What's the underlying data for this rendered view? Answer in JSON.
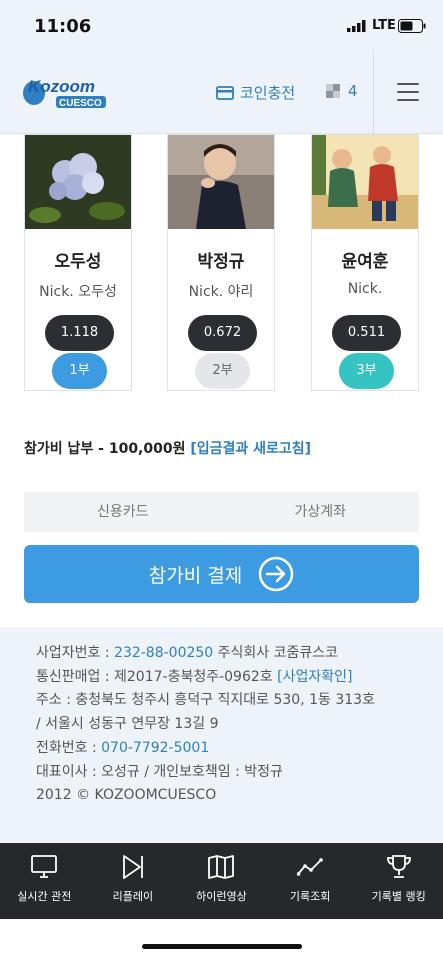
{
  "status": {
    "time": "11:06",
    "network": "LTE"
  },
  "header": {
    "logo_text": "Kozoom",
    "logo_sub": "CUESCO",
    "charge_label": "코인충전",
    "coin_count": "4"
  },
  "players": [
    {
      "name": "오두성",
      "nick": "Nick. 오두성",
      "score": "1.118",
      "part": "1부",
      "part_color": "#3d9be2"
    },
    {
      "name": "박정규",
      "nick": "Nick. 야리",
      "score": "0.672",
      "part": "2부",
      "part_color": "#e4e6ea"
    },
    {
      "name": "윤여훈",
      "nick": "Nick.",
      "score": "0.511",
      "part": "3부",
      "part_color": "#35c4c2"
    }
  ],
  "fee": {
    "text": "참가비 납부 - 100,000원 ",
    "refresh": "[입금결과 새로고침]"
  },
  "payment": {
    "tabs": [
      "신용카드",
      "가상계좌"
    ],
    "button_label": "참가비 결제"
  },
  "company": {
    "biz_label": "사업자번호 : ",
    "biz_no": "232-88-00250",
    "biz_name": " 주식회사 코줌큐스코",
    "sales_text": "통신판매업 : 제2017-충북청주-0962호 ",
    "sales_link": "[사업자확인]",
    "address": "주소 : 충청북도 청주시 흥덕구 직지대로 530, 1동 313호",
    "address2": "/ 서울시 성동구 연무장 13길 9",
    "phone_label": "전화번호 : ",
    "phone": "070-7792-5001",
    "ceo": "대표이사 : 오성규 / 개인보호책임 : 박정규",
    "copyright": "2012 © KOZOOMCUESCO"
  },
  "tabbar": [
    {
      "label": "실시간 관전",
      "icon": "monitor-icon"
    },
    {
      "label": "리플레이",
      "icon": "play-icon"
    },
    {
      "label": "하이런영상",
      "icon": "book-icon"
    },
    {
      "label": "기록조회",
      "icon": "chart-icon"
    },
    {
      "label": "기록별 랭킹",
      "icon": "trophy-icon"
    }
  ],
  "colors": {
    "accent": "#3d9be2",
    "link": "#2f7fc1",
    "dark": "#2b2e33",
    "tabbar": "#26282c"
  }
}
